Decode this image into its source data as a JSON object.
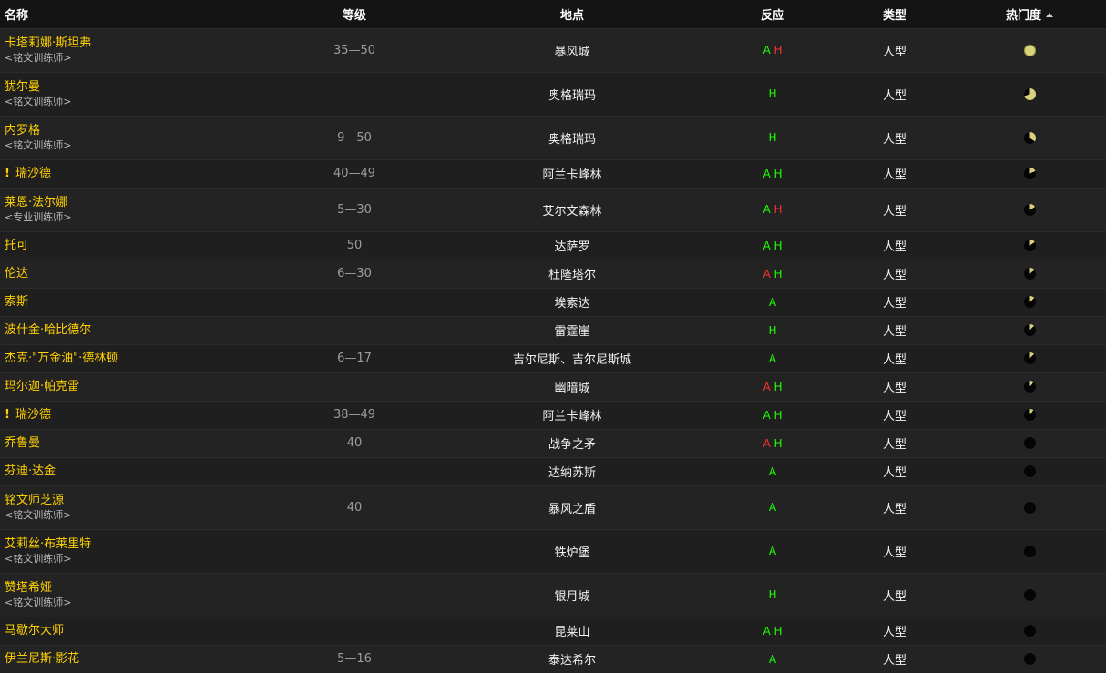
{
  "header": {
    "name": "名称",
    "level": "等级",
    "location": "地点",
    "reaction": "反应",
    "type": "类型",
    "popularity": "热门度"
  },
  "colors": {
    "alliance": "#1eff00",
    "horde": "#ff3030",
    "name": "#ffd100",
    "pie_fill": "#d8d27a",
    "pie_bg": "#050505"
  },
  "rows": [
    {
      "name": "卡塔莉娜·斯坦弗",
      "sub": "<铭文训练师>",
      "quest": false,
      "level": "35—50",
      "location": "暴风城",
      "reaction": [
        {
          "t": "A",
          "c": "g"
        },
        {
          "t": "H",
          "c": "r"
        }
      ],
      "type": "人型",
      "popularity": 1.0
    },
    {
      "name": "犹尔曼",
      "sub": "<铭文训练师>",
      "quest": false,
      "level": "",
      "location": "奥格瑞玛",
      "reaction": [
        {
          "t": "H",
          "c": "g"
        }
      ],
      "type": "人型",
      "popularity": 0.7
    },
    {
      "name": "内罗格",
      "sub": "<铭文训练师>",
      "quest": false,
      "level": "9—50",
      "location": "奥格瑞玛",
      "reaction": [
        {
          "t": "H",
          "c": "g"
        }
      ],
      "type": "人型",
      "popularity": 0.35
    },
    {
      "name": "瑞沙德",
      "sub": "",
      "quest": true,
      "level": "40—49",
      "location": "阿兰卡峰林",
      "reaction": [
        {
          "t": "A",
          "c": "g"
        },
        {
          "t": "H",
          "c": "g"
        }
      ],
      "type": "人型",
      "popularity": 0.18
    },
    {
      "name": "莱恩·法尔娜",
      "sub": "<专业训练师>",
      "quest": false,
      "level": "5—30",
      "location": "艾尔文森林",
      "reaction": [
        {
          "t": "A",
          "c": "g"
        },
        {
          "t": "H",
          "c": "r"
        }
      ],
      "type": "人型",
      "popularity": 0.16
    },
    {
      "name": "托可",
      "sub": "",
      "quest": false,
      "level": "50",
      "location": "达萨罗",
      "reaction": [
        {
          "t": "A",
          "c": "g"
        },
        {
          "t": "H",
          "c": "g"
        }
      ],
      "type": "人型",
      "popularity": 0.15
    },
    {
      "name": "伦达",
      "sub": "",
      "quest": false,
      "level": "6—30",
      "location": "杜隆塔尔",
      "reaction": [
        {
          "t": "A",
          "c": "r"
        },
        {
          "t": "H",
          "c": "g"
        }
      ],
      "type": "人型",
      "popularity": 0.14
    },
    {
      "name": "索斯",
      "sub": "",
      "quest": false,
      "level": "",
      "location": "埃索达",
      "reaction": [
        {
          "t": "A",
          "c": "g"
        }
      ],
      "type": "人型",
      "popularity": 0.13
    },
    {
      "name": "波什金·哈比德尔",
      "sub": "",
      "quest": false,
      "level": "",
      "location": "雷霆崖",
      "reaction": [
        {
          "t": "H",
          "c": "g"
        }
      ],
      "type": "人型",
      "popularity": 0.12
    },
    {
      "name": "杰克·\"万金油\"·德林顿",
      "sub": "",
      "quest": false,
      "level": "6—17",
      "location": "吉尔尼斯、吉尔尼斯城",
      "reaction": [
        {
          "t": "A",
          "c": "g"
        }
      ],
      "type": "人型",
      "popularity": 0.12
    },
    {
      "name": "玛尔迦·帕克雷",
      "sub": "",
      "quest": false,
      "level": "",
      "location": "幽暗城",
      "reaction": [
        {
          "t": "A",
          "c": "r"
        },
        {
          "t": "H",
          "c": "g"
        }
      ],
      "type": "人型",
      "popularity": 0.11
    },
    {
      "name": "瑞沙德",
      "sub": "",
      "quest": true,
      "level": "38—49",
      "location": "阿兰卡峰林",
      "reaction": [
        {
          "t": "A",
          "c": "g"
        },
        {
          "t": "H",
          "c": "g"
        }
      ],
      "type": "人型",
      "popularity": 0.1
    },
    {
      "name": "乔鲁曼",
      "sub": "",
      "quest": false,
      "level": "40",
      "location": "战争之矛",
      "reaction": [
        {
          "t": "A",
          "c": "r"
        },
        {
          "t": "H",
          "c": "g"
        }
      ],
      "type": "人型",
      "popularity": 0.0
    },
    {
      "name": "芬迪·达金",
      "sub": "",
      "quest": false,
      "level": "",
      "location": "达纳苏斯",
      "reaction": [
        {
          "t": "A",
          "c": "g"
        }
      ],
      "type": "人型",
      "popularity": 0.0
    },
    {
      "name": "铭文师芝源",
      "sub": "<铭文训练师>",
      "quest": false,
      "level": "40",
      "location": "暴风之盾",
      "reaction": [
        {
          "t": "A",
          "c": "g"
        }
      ],
      "type": "人型",
      "popularity": 0.0
    },
    {
      "name": "艾莉丝·布莱里特",
      "sub": "<铭文训练师>",
      "quest": false,
      "level": "",
      "location": "铁炉堡",
      "reaction": [
        {
          "t": "A",
          "c": "g"
        }
      ],
      "type": "人型",
      "popularity": 0.0
    },
    {
      "name": "赞塔希娅",
      "sub": "<铭文训练师>",
      "quest": false,
      "level": "",
      "location": "银月城",
      "reaction": [
        {
          "t": "H",
          "c": "g"
        }
      ],
      "type": "人型",
      "popularity": 0.0
    },
    {
      "name": "马歇尔大师",
      "sub": "",
      "quest": false,
      "level": "",
      "location": "昆莱山",
      "reaction": [
        {
          "t": "A",
          "c": "g"
        },
        {
          "t": "H",
          "c": "g"
        }
      ],
      "type": "人型",
      "popularity": 0.0
    },
    {
      "name": "伊兰尼斯·影花",
      "sub": "",
      "quest": false,
      "level": "5—16",
      "location": "泰达希尔",
      "reaction": [
        {
          "t": "A",
          "c": "g"
        }
      ],
      "type": "人型",
      "popularity": 0.0
    }
  ]
}
